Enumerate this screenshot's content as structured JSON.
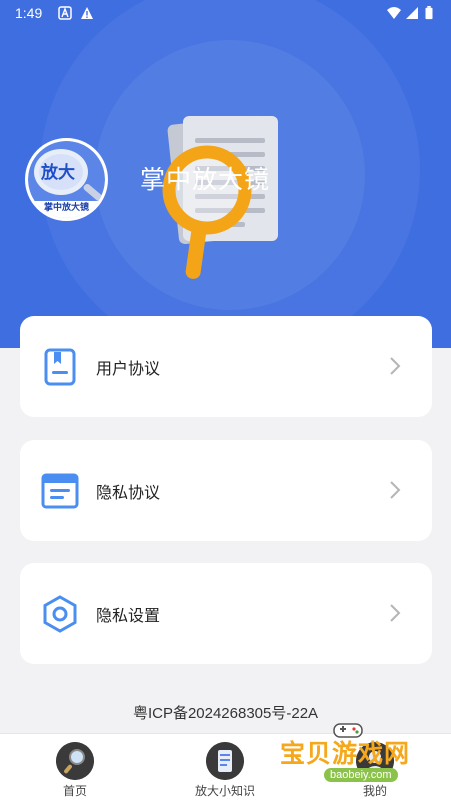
{
  "status_bar": {
    "time": "1:49",
    "left_icons": [
      "a-icon",
      "warning-icon"
    ],
    "right_icons": [
      "wifi-icon",
      "signal-icon",
      "battery-icon"
    ]
  },
  "header": {
    "app_title": "掌中放大镜",
    "avatar_text": "放大",
    "avatar_caption": "掌中放大镜"
  },
  "menu": {
    "items": [
      {
        "label": "用户协议",
        "icon": "bookmark-doc-icon"
      },
      {
        "label": "隐私协议",
        "icon": "list-doc-icon"
      },
      {
        "label": "隐私设置",
        "icon": "hexagon-settings-icon"
      }
    ]
  },
  "footer": {
    "icp": "粤ICP备2024268305号-22A"
  },
  "tabs": [
    {
      "label": "首页",
      "icon": "magnifier-icon"
    },
    {
      "label": "放大小知识",
      "icon": "phone-doc-icon"
    },
    {
      "label": "我的",
      "icon": "profile-icon"
    }
  ],
  "watermark": {
    "title": "宝贝游戏网",
    "url": "baobeiy.com"
  },
  "colors": {
    "primary": "#3f6ee0",
    "icon_blue": "#4a8ef2",
    "background": "#f2f2f4",
    "watermark_orange": "#f5a81c"
  }
}
